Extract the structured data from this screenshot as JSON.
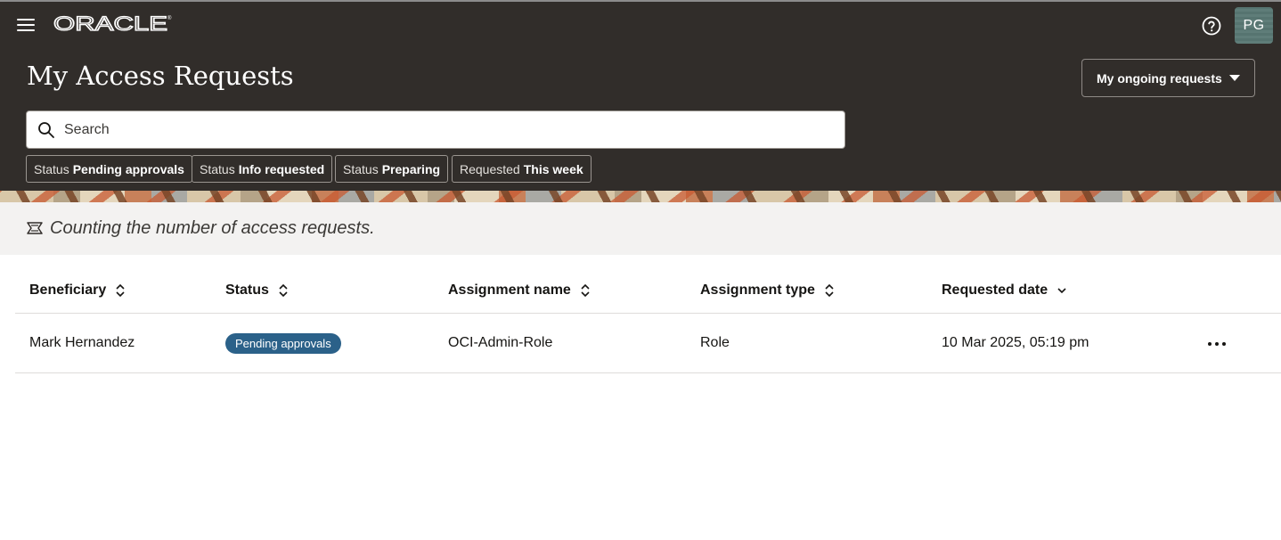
{
  "header": {
    "brand": "ORACLE",
    "page_title": "My Access Requests",
    "avatar_initials": "PG",
    "view_select": {
      "selected": "My ongoing requests"
    },
    "search": {
      "placeholder": "Search",
      "value": ""
    },
    "filter_chips": [
      {
        "key": "Status",
        "value": "Pending approvals"
      },
      {
        "key": "Status",
        "value": "Info requested"
      },
      {
        "key": "Status",
        "value": "Preparing"
      },
      {
        "key": "Requested",
        "value": "This week"
      }
    ],
    "icons": {
      "menu": "hamburger-menu-icon",
      "help": "help-circle-icon",
      "search": "search-icon",
      "caret": "caret-down-icon"
    }
  },
  "status_bar": {
    "message": "Counting the number of access requests.",
    "icon": "ribbon-icon"
  },
  "table": {
    "columns": [
      {
        "label": "Beneficiary",
        "sort": "unsorted"
      },
      {
        "label": "Status",
        "sort": "unsorted"
      },
      {
        "label": "Assignment name",
        "sort": "unsorted"
      },
      {
        "label": "Assignment type",
        "sort": "unsorted"
      },
      {
        "label": "Requested date",
        "sort": "descending"
      }
    ],
    "rows": [
      {
        "beneficiary": "Mark Hernandez",
        "status": "Pending approvals",
        "assignment_name": "OCI-Admin-Role",
        "assignment_type": "Role",
        "requested_date": "10 Mar 2025, 05:19 pm",
        "actions_icon": "more-actions-icon"
      }
    ]
  },
  "colors": {
    "header_bg": "#312d2a",
    "status_bar_bg": "#f3f2f1",
    "badge_bg": "#2b6189",
    "text": "#161513"
  }
}
